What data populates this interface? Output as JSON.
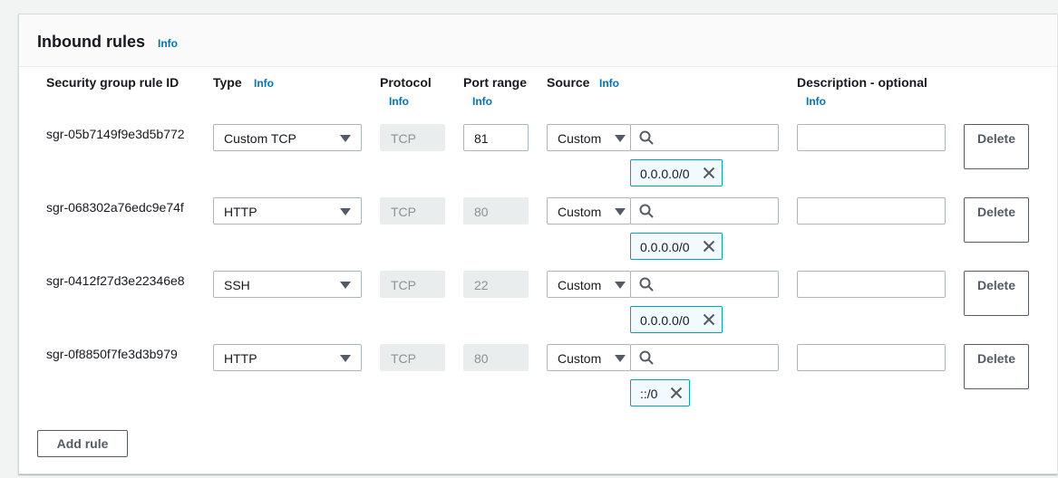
{
  "header": {
    "title": "Inbound rules",
    "info": "Info"
  },
  "columns": {
    "rule_id": "Security group rule ID",
    "type": "Type",
    "type_info": "Info",
    "protocol": "Protocol",
    "protocol_info": "Info",
    "port_range": "Port range",
    "port_info": "Info",
    "source": "Source",
    "source_info": "Info",
    "description": "Description - optional",
    "description_info": "Info"
  },
  "rules": [
    {
      "id": "sgr-05b7149f9e3d5b772",
      "type": "Custom TCP",
      "protocol": "TCP",
      "port": "81",
      "port_editable": true,
      "source_type": "Custom",
      "cidr": "0.0.0.0/0",
      "description": "",
      "delete": "Delete"
    },
    {
      "id": "sgr-068302a76edc9e74f",
      "type": "HTTP",
      "protocol": "TCP",
      "port": "80",
      "port_editable": false,
      "source_type": "Custom",
      "cidr": "0.0.0.0/0",
      "description": "",
      "delete": "Delete"
    },
    {
      "id": "sgr-0412f27d3e22346e8",
      "type": "SSH",
      "protocol": "TCP",
      "port": "22",
      "port_editable": false,
      "source_type": "Custom",
      "cidr": "0.0.0.0/0",
      "description": "",
      "delete": "Delete"
    },
    {
      "id": "sgr-0f8850f7fe3d3b979",
      "type": "HTTP",
      "protocol": "TCP",
      "port": "80",
      "port_editable": false,
      "source_type": "Custom",
      "cidr": "::/0",
      "description": "",
      "delete": "Delete"
    }
  ],
  "add_rule_label": "Add rule",
  "colors": {
    "info_link": "#0073bb",
    "token_border": "#00a1c9",
    "token_bg": "#f1faff"
  },
  "icons": {
    "search": "search-icon",
    "remove": "close-icon",
    "dropdown": "caret-down-icon"
  }
}
